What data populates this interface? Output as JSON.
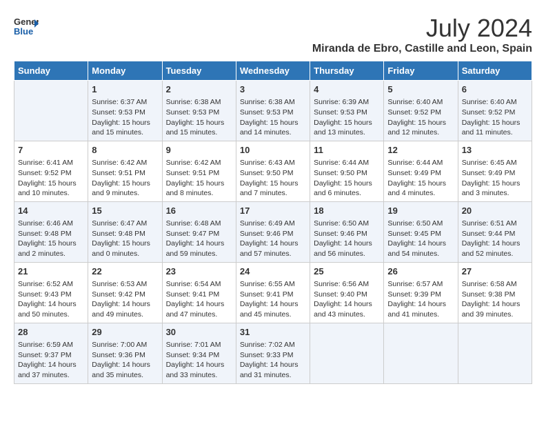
{
  "logo": {
    "text_general": "General",
    "text_blue": "Blue"
  },
  "header": {
    "month_year": "July 2024",
    "location": "Miranda de Ebro, Castille and Leon, Spain"
  },
  "weekdays": [
    "Sunday",
    "Monday",
    "Tuesday",
    "Wednesday",
    "Thursday",
    "Friday",
    "Saturday"
  ],
  "weeks": [
    [
      {
        "day": "",
        "info": ""
      },
      {
        "day": "1",
        "info": "Sunrise: 6:37 AM\nSunset: 9:53 PM\nDaylight: 15 hours and 15 minutes."
      },
      {
        "day": "2",
        "info": "Sunrise: 6:38 AM\nSunset: 9:53 PM\nDaylight: 15 hours and 15 minutes."
      },
      {
        "day": "3",
        "info": "Sunrise: 6:38 AM\nSunset: 9:53 PM\nDaylight: 15 hours and 14 minutes."
      },
      {
        "day": "4",
        "info": "Sunrise: 6:39 AM\nSunset: 9:53 PM\nDaylight: 15 hours and 13 minutes."
      },
      {
        "day": "5",
        "info": "Sunrise: 6:40 AM\nSunset: 9:52 PM\nDaylight: 15 hours and 12 minutes."
      },
      {
        "day": "6",
        "info": "Sunrise: 6:40 AM\nSunset: 9:52 PM\nDaylight: 15 hours and 11 minutes."
      }
    ],
    [
      {
        "day": "7",
        "info": "Sunrise: 6:41 AM\nSunset: 9:52 PM\nDaylight: 15 hours and 10 minutes."
      },
      {
        "day": "8",
        "info": "Sunrise: 6:42 AM\nSunset: 9:51 PM\nDaylight: 15 hours and 9 minutes."
      },
      {
        "day": "9",
        "info": "Sunrise: 6:42 AM\nSunset: 9:51 PM\nDaylight: 15 hours and 8 minutes."
      },
      {
        "day": "10",
        "info": "Sunrise: 6:43 AM\nSunset: 9:50 PM\nDaylight: 15 hours and 7 minutes."
      },
      {
        "day": "11",
        "info": "Sunrise: 6:44 AM\nSunset: 9:50 PM\nDaylight: 15 hours and 6 minutes."
      },
      {
        "day": "12",
        "info": "Sunrise: 6:44 AM\nSunset: 9:49 PM\nDaylight: 15 hours and 4 minutes."
      },
      {
        "day": "13",
        "info": "Sunrise: 6:45 AM\nSunset: 9:49 PM\nDaylight: 15 hours and 3 minutes."
      }
    ],
    [
      {
        "day": "14",
        "info": "Sunrise: 6:46 AM\nSunset: 9:48 PM\nDaylight: 15 hours and 2 minutes."
      },
      {
        "day": "15",
        "info": "Sunrise: 6:47 AM\nSunset: 9:48 PM\nDaylight: 15 hours and 0 minutes."
      },
      {
        "day": "16",
        "info": "Sunrise: 6:48 AM\nSunset: 9:47 PM\nDaylight: 14 hours and 59 minutes."
      },
      {
        "day": "17",
        "info": "Sunrise: 6:49 AM\nSunset: 9:46 PM\nDaylight: 14 hours and 57 minutes."
      },
      {
        "day": "18",
        "info": "Sunrise: 6:50 AM\nSunset: 9:46 PM\nDaylight: 14 hours and 56 minutes."
      },
      {
        "day": "19",
        "info": "Sunrise: 6:50 AM\nSunset: 9:45 PM\nDaylight: 14 hours and 54 minutes."
      },
      {
        "day": "20",
        "info": "Sunrise: 6:51 AM\nSunset: 9:44 PM\nDaylight: 14 hours and 52 minutes."
      }
    ],
    [
      {
        "day": "21",
        "info": "Sunrise: 6:52 AM\nSunset: 9:43 PM\nDaylight: 14 hours and 50 minutes."
      },
      {
        "day": "22",
        "info": "Sunrise: 6:53 AM\nSunset: 9:42 PM\nDaylight: 14 hours and 49 minutes."
      },
      {
        "day": "23",
        "info": "Sunrise: 6:54 AM\nSunset: 9:41 PM\nDaylight: 14 hours and 47 minutes."
      },
      {
        "day": "24",
        "info": "Sunrise: 6:55 AM\nSunset: 9:41 PM\nDaylight: 14 hours and 45 minutes."
      },
      {
        "day": "25",
        "info": "Sunrise: 6:56 AM\nSunset: 9:40 PM\nDaylight: 14 hours and 43 minutes."
      },
      {
        "day": "26",
        "info": "Sunrise: 6:57 AM\nSunset: 9:39 PM\nDaylight: 14 hours and 41 minutes."
      },
      {
        "day": "27",
        "info": "Sunrise: 6:58 AM\nSunset: 9:38 PM\nDaylight: 14 hours and 39 minutes."
      }
    ],
    [
      {
        "day": "28",
        "info": "Sunrise: 6:59 AM\nSunset: 9:37 PM\nDaylight: 14 hours and 37 minutes."
      },
      {
        "day": "29",
        "info": "Sunrise: 7:00 AM\nSunset: 9:36 PM\nDaylight: 14 hours and 35 minutes."
      },
      {
        "day": "30",
        "info": "Sunrise: 7:01 AM\nSunset: 9:34 PM\nDaylight: 14 hours and 33 minutes."
      },
      {
        "day": "31",
        "info": "Sunrise: 7:02 AM\nSunset: 9:33 PM\nDaylight: 14 hours and 31 minutes."
      },
      {
        "day": "",
        "info": ""
      },
      {
        "day": "",
        "info": ""
      },
      {
        "day": "",
        "info": ""
      }
    ]
  ]
}
